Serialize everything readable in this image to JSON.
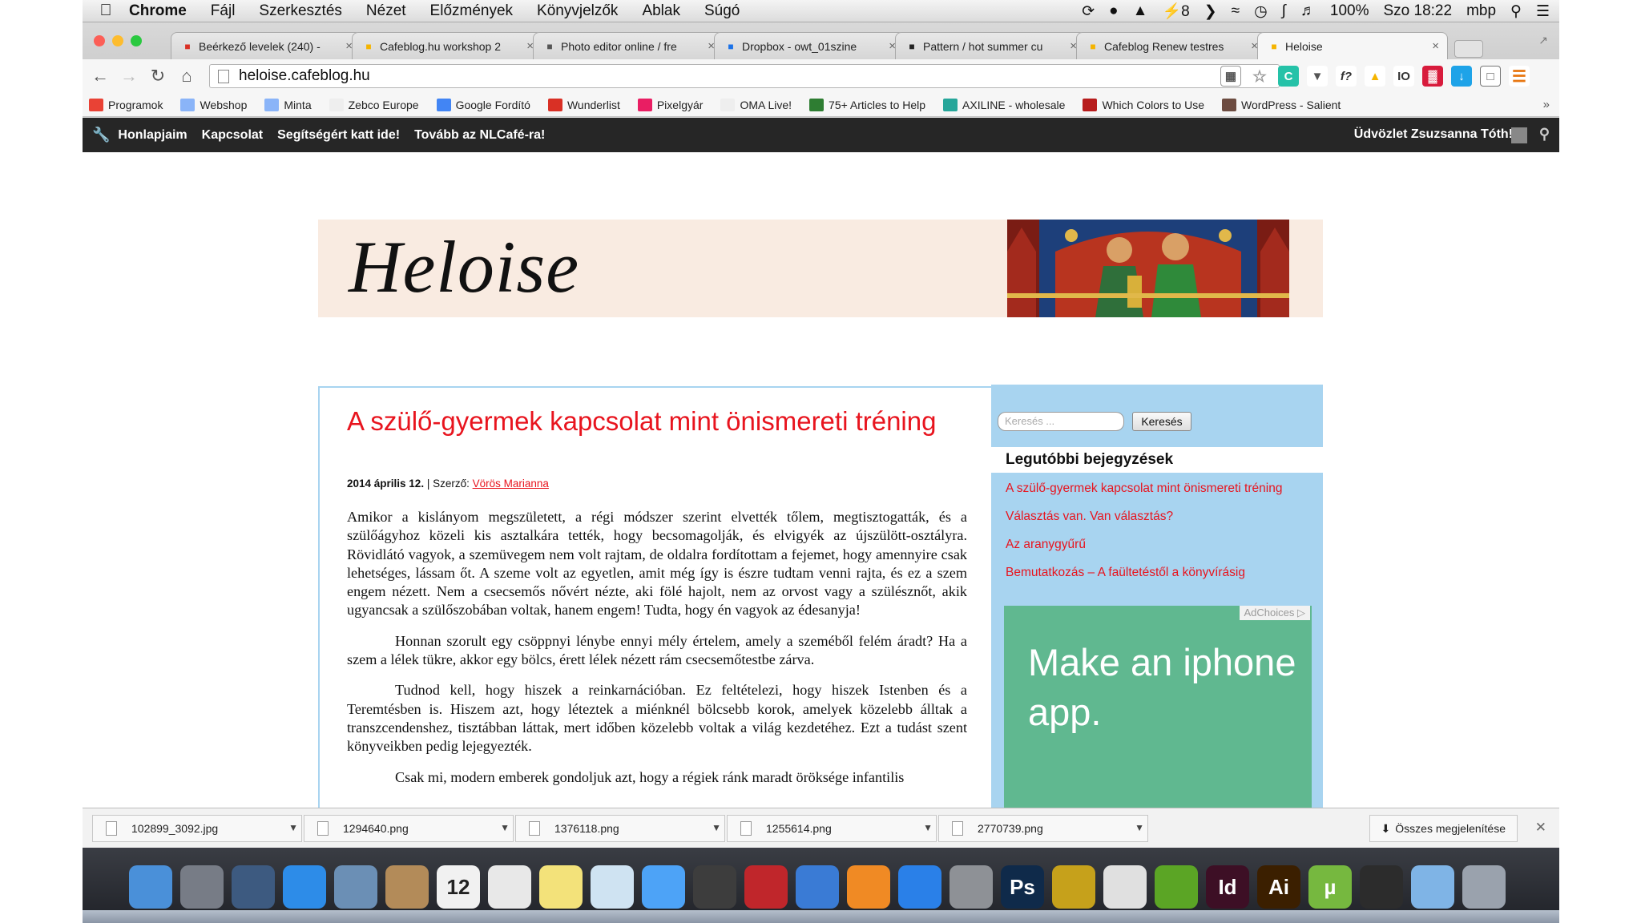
{
  "menubar": {
    "app": "Chrome",
    "items": [
      "Fájl",
      "Szerkesztés",
      "Nézet",
      "Előzmények",
      "Könyvjelzők",
      "Ablak",
      "Súgó"
    ],
    "notif_count": "8",
    "battery": "100%",
    "clock": "Szo 18:22",
    "user": "mbp"
  },
  "tabs": [
    {
      "title": "Beérkező levelek (240) -",
      "favicon": "gmail-icon",
      "color": "#d93025"
    },
    {
      "title": "Cafeblog.hu workshop 2",
      "favicon": "folder-icon",
      "color": "#f5b400"
    },
    {
      "title": "Photo editor online / fre",
      "favicon": "pencil-icon",
      "color": "#555555"
    },
    {
      "title": "Dropbox - owt_01szine",
      "favicon": "dropbox-icon",
      "color": "#1b72e8"
    },
    {
      "title": "Pattern / hot summer cu",
      "favicon": "heart-icon",
      "color": "#222222"
    },
    {
      "title": "Cafeblog Renew testres",
      "favicon": "cb-icon",
      "color": "#f5b400"
    },
    {
      "title": "Heloise",
      "favicon": "cb-icon",
      "color": "#f5b400"
    }
  ],
  "address": "heloise.cafeblog.hu",
  "bookmarks": [
    {
      "label": "Programok",
      "color": "#e94235"
    },
    {
      "label": "Webshop",
      "color": "#8ab4f8"
    },
    {
      "label": "Minta",
      "color": "#8ab4f8"
    },
    {
      "label": "Zebco Europe",
      "color": "#eeeeee"
    },
    {
      "label": "Google Fordító",
      "color": "#4285f4"
    },
    {
      "label": "Wunderlist",
      "color": "#d93025"
    },
    {
      "label": "Pixelgyár",
      "color": "#e91e63"
    },
    {
      "label": "OMA Live!",
      "color": "#eeeeee"
    },
    {
      "label": "75+ Articles to Help",
      "color": "#2e7d32"
    },
    {
      "label": "AXILINE - wholesale",
      "color": "#26a69a"
    },
    {
      "label": "Which Colors to Use",
      "color": "#b71c1c"
    },
    {
      "label": "WordPress - Salient",
      "color": "#6d4c41"
    }
  ],
  "adminbar": {
    "items": [
      "Honlapjaim",
      "Kapcsolat",
      "Segítségért katt ide!",
      "Tovább az NLCafé-ra!"
    ],
    "greeting": "Üdvözlet Zsuzsanna Tóth!"
  },
  "blog": {
    "logo": "Heloise",
    "post_title": "A szülő-gyermek kapcsolat mint önismereti tréning",
    "date": "2014 április 12.",
    "author_label": "| Szerző:",
    "author": "Vörös Marianna",
    "paragraphs": [
      "Amikor a kislányom megszületett, a régi módszer szerint elvették tőlem, megtisztogatták, és a szülőágyhoz közeli kis asztalkára tették, hogy becsomagolják, és elvigyék az újszülött-osztályra. Rövidlátó vagyok, a szemüvegem nem volt rajtam, de oldalra fordítottam a fejemet, hogy amennyire csak lehetséges, lássam őt. A szeme volt az egyetlen, amit még így is észre tudtam venni rajta, és ez a szem engem nézett. Nem a csecsemős nővért nézte, aki fölé hajolt, nem az orvost vagy a szülésznőt, akik ugyancsak a szülőszobában voltak, hanem engem! Tudta, hogy én vagyok az édesanyja!",
      "Honnan szorult egy csöppnyi lénybe ennyi mély értelem, amely a szeméből felém áradt? Ha a szem a lélek tükre, akkor egy bölcs, érett lélek nézett rám csecsemőtestbe zárva.",
      "Tudnod kell, hogy hiszek a reinkarnációban. Ez feltételezi, hogy hiszek Istenben és a Teremtésben is. Hiszem azt, hogy léteztek a miénknél bölcsebb korok, amelyek közelebb álltak a transzcendenshez, tisztábban láttak, mert időben közelebb voltak a világ kezdetéhez. Ezt a tudást szent könyveikben pedig lejegyezték.",
      "Csak mi, modern emberek gondoljuk azt, hogy a régiek ránk maradt öröksége infantilis"
    ]
  },
  "sidebar": {
    "search_placeholder": "Keresés ...",
    "search_button": "Keresés",
    "recent_title": "Legutóbbi bejegyzések",
    "recent": [
      "A szülő-gyermek kapcsolat mint önismereti tréning",
      "Választás van. Van választás?",
      "Az aranygyűrű",
      "Bemutatkozás – A faültetéstől a könyvírásig"
    ],
    "ad_choices": "AdChoices",
    "ad_text": "Make an iphone app."
  },
  "downloads": {
    "files": [
      "102899_3092.jpg",
      "1294640.png",
      "1376118.png",
      "1255614.png",
      "2770739.png"
    ],
    "show_all": "Összes megjelenítése"
  },
  "dock": {
    "calendar_day": "12",
    "apps": [
      {
        "name": "finder-icon",
        "color": "#4a90d9",
        "glyph": ""
      },
      {
        "name": "launchpad-icon",
        "color": "#777c86",
        "glyph": ""
      },
      {
        "name": "mission-control-icon",
        "color": "#3d5a80",
        "glyph": ""
      },
      {
        "name": "safari-icon",
        "color": "#2d8ce8",
        "glyph": ""
      },
      {
        "name": "mail-icon",
        "color": "#6b8fb5",
        "glyph": ""
      },
      {
        "name": "contacts-icon",
        "color": "#b38b59",
        "glyph": ""
      },
      {
        "name": "calendar-icon",
        "color": "#f1f1f1",
        "glyph": "12"
      },
      {
        "name": "reminders-icon",
        "color": "#e8e8e8",
        "glyph": ""
      },
      {
        "name": "notes-icon",
        "color": "#f3e27a",
        "glyph": ""
      },
      {
        "name": "preview-icon",
        "color": "#cfe3f2",
        "glyph": ""
      },
      {
        "name": "messages-icon",
        "color": "#4da3f7",
        "glyph": ""
      },
      {
        "name": "facetime-icon",
        "color": "#3d3d3d",
        "glyph": ""
      },
      {
        "name": "photo-booth-icon",
        "color": "#c0262b",
        "glyph": ""
      },
      {
        "name": "itunes-icon",
        "color": "#3a7bd5",
        "glyph": ""
      },
      {
        "name": "ibooks-icon",
        "color": "#f08a24",
        "glyph": ""
      },
      {
        "name": "app-store-icon",
        "color": "#2a80e8",
        "glyph": ""
      },
      {
        "name": "system-preferences-icon",
        "color": "#8e9196",
        "glyph": ""
      },
      {
        "name": "photoshop-icon",
        "color": "#0f2a4a",
        "glyph": "Ps"
      },
      {
        "name": "globe-icon",
        "color": "#c6a11b",
        "glyph": ""
      },
      {
        "name": "chrome-icon",
        "color": "#e0e0e0",
        "glyph": ""
      },
      {
        "name": "evernote-icon",
        "color": "#5ba525",
        "glyph": ""
      },
      {
        "name": "indesign-icon",
        "color": "#3d0f25",
        "glyph": "Id"
      },
      {
        "name": "illustrator-icon",
        "color": "#3b1f00",
        "glyph": "Ai"
      },
      {
        "name": "utorrent-icon",
        "color": "#76b83f",
        "glyph": "µ"
      },
      {
        "name": "xcode-icon",
        "color": "#2c2c2c",
        "glyph": ""
      },
      {
        "name": "downloads-folder-icon",
        "color": "#7fb4e6",
        "glyph": ""
      },
      {
        "name": "trash-icon",
        "color": "#9aa2ad",
        "glyph": ""
      }
    ]
  },
  "colors": {
    "accent_red": "#e8141e",
    "sidebar_blue": "#a8d4f0",
    "ad_green": "#60b890",
    "adminbar": "#262626"
  }
}
